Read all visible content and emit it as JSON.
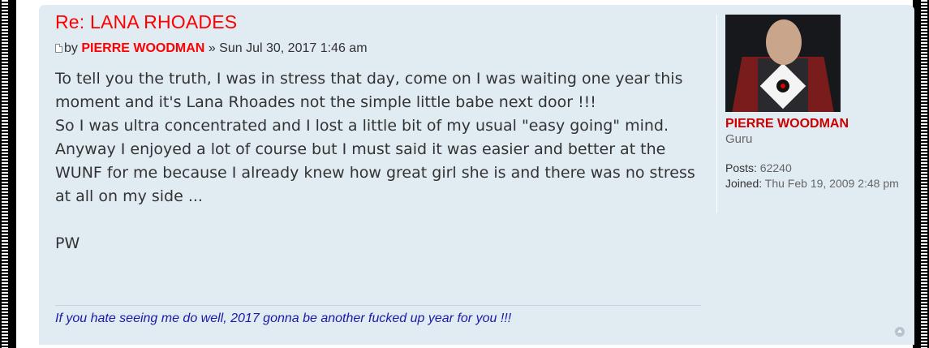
{
  "post": {
    "title": "Re: LANA RHOADES",
    "by_label": "by",
    "author": "PIERRE WOODMAN",
    "separator": "»",
    "timestamp": "Sun Jul 30, 2017 1:46 am",
    "paragraphs": [
      "To tell you the truth, I was in stress that day, come on I was waiting one year this moment and it's Lana Rhoades not the simple little babe next door !!!",
      "So I was ultra concentrated and I lost a little bit of my usual \"easy going\" mind.",
      "Anyway I enjoyed a lot of course but I must said it was easier and better at the WUNF for me because I already knew how great girl she is and there was no stress at all on my side ...",
      "PW"
    ],
    "signature": "If you hate seeing me do well, 2017 gonna be another fucked up year for you !!!"
  },
  "profile": {
    "name": "PIERRE WOODMAN",
    "rank": "Guru",
    "posts_label": "Posts:",
    "posts_value": "62240",
    "joined_label": "Joined:",
    "joined_value": "Thu Feb 19, 2009 2:48 pm"
  },
  "icons": {
    "post_icon": "post-icon",
    "top_icon": "back-to-top-icon"
  },
  "colors": {
    "title": "#ff0000",
    "author": "#ff0000",
    "profile_name": "#cc0000",
    "signature": "#1a1aa8",
    "post_bg": "#e1ebf2"
  }
}
